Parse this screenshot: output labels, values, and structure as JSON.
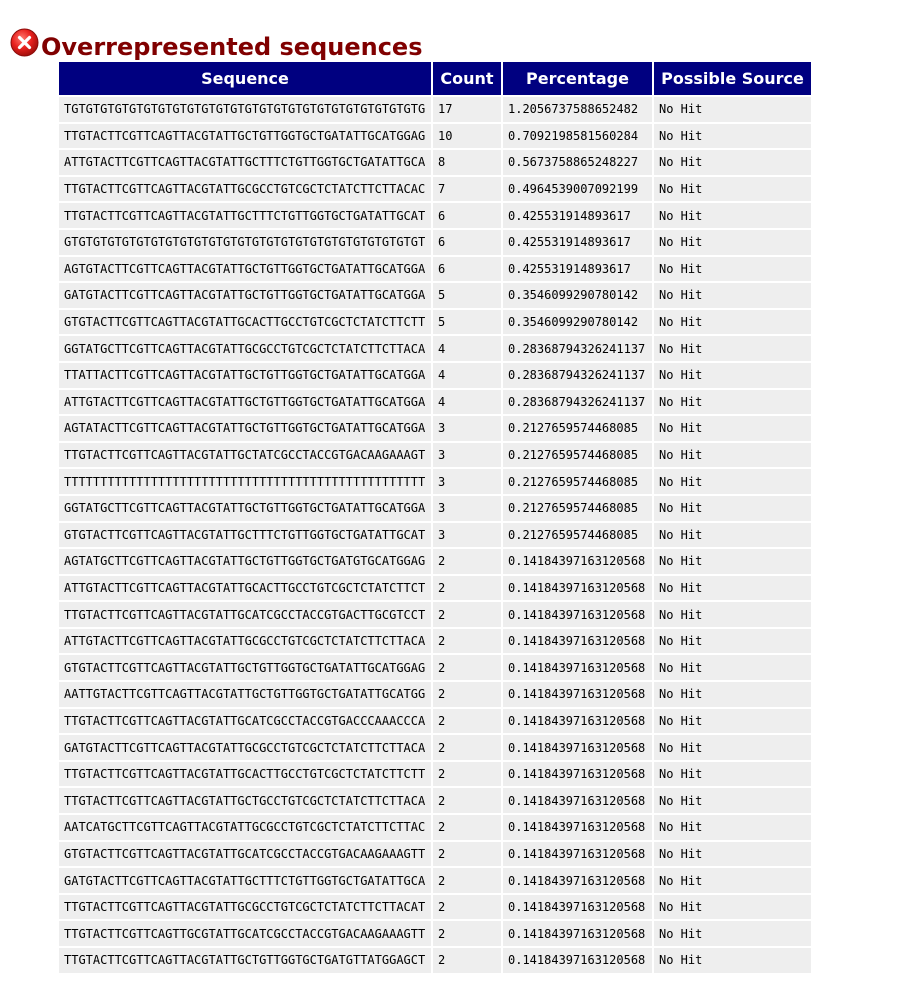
{
  "report": {
    "title": "Overrepresented sequences",
    "status": "fail",
    "status_icon": "fail-cross-icon",
    "status_color": "#e8211e",
    "title_color": "#800000",
    "header_bg": "#000080"
  },
  "table": {
    "columns": [
      "Sequence",
      "Count",
      "Percentage",
      "Possible Source"
    ],
    "rows": [
      {
        "sequence": "TGTGTGTGTGTGTGTGTGTGTGTGTGTGTGTGTGTGTGTGTGTGTGTGTG",
        "count": "17",
        "percentage": "1.2056737588652482",
        "source": "No Hit"
      },
      {
        "sequence": "TTGTACTTCGTTCAGTTACGTATTGCTGTTGGTGCTGATATTGCATGGAG",
        "count": "10",
        "percentage": "0.7092198581560284",
        "source": "No Hit"
      },
      {
        "sequence": "ATTGTACTTCGTTCAGTTACGTATTGCTTTCTGTTGGTGCTGATATTGCA",
        "count": "8",
        "percentage": "0.5673758865248227",
        "source": "No Hit"
      },
      {
        "sequence": "TTGTACTTCGTTCAGTTACGTATTGCGCCTGTCGCTCTATCTTCTTACAC",
        "count": "7",
        "percentage": "0.4964539007092199",
        "source": "No Hit"
      },
      {
        "sequence": "TTGTACTTCGTTCAGTTACGTATTGCTTTCTGTTGGTGCTGATATTGCAT",
        "count": "6",
        "percentage": "0.425531914893617",
        "source": "No Hit"
      },
      {
        "sequence": "GTGTGTGTGTGTGTGTGTGTGTGTGTGTGTGTGTGTGTGTGTGTGTGTGT",
        "count": "6",
        "percentage": "0.425531914893617",
        "source": "No Hit"
      },
      {
        "sequence": "AGTGTACTTCGTTCAGTTACGTATTGCTGTTGGTGCTGATATTGCATGGA",
        "count": "6",
        "percentage": "0.425531914893617",
        "source": "No Hit"
      },
      {
        "sequence": "GATGTACTTCGTTCAGTTACGTATTGCTGTTGGTGCTGATATTGCATGGA",
        "count": "5",
        "percentage": "0.3546099290780142",
        "source": "No Hit"
      },
      {
        "sequence": "GTGTACTTCGTTCAGTTACGTATTGCACTTGCCTGTCGCTCTATCTTCTT",
        "count": "5",
        "percentage": "0.3546099290780142",
        "source": "No Hit"
      },
      {
        "sequence": "GGTATGCTTCGTTCAGTTACGTATTGCGCCTGTCGCTCTATCTTCTTACA",
        "count": "4",
        "percentage": "0.28368794326241137",
        "source": "No Hit"
      },
      {
        "sequence": "TTATTACTTCGTTCAGTTACGTATTGCTGTTGGTGCTGATATTGCATGGA",
        "count": "4",
        "percentage": "0.28368794326241137",
        "source": "No Hit"
      },
      {
        "sequence": "ATTGTACTTCGTTCAGTTACGTATTGCTGTTGGTGCTGATATTGCATGGA",
        "count": "4",
        "percentage": "0.28368794326241137",
        "source": "No Hit"
      },
      {
        "sequence": "AGTATACTTCGTTCAGTTACGTATTGCTGTTGGTGCTGATATTGCATGGA",
        "count": "3",
        "percentage": "0.2127659574468085",
        "source": "No Hit"
      },
      {
        "sequence": "TTGTACTTCGTTCAGTTACGTATTGCTATCGCCTACCGTGACAAGAAAGT",
        "count": "3",
        "percentage": "0.2127659574468085",
        "source": "No Hit"
      },
      {
        "sequence": "TTTTTTTTTTTTTTTTTTTTTTTTTTTTTTTTTTTTTTTTTTTTTTTTTT",
        "count": "3",
        "percentage": "0.2127659574468085",
        "source": "No Hit"
      },
      {
        "sequence": "GGTATGCTTCGTTCAGTTACGTATTGCTGTTGGTGCTGATATTGCATGGA",
        "count": "3",
        "percentage": "0.2127659574468085",
        "source": "No Hit"
      },
      {
        "sequence": "GTGTACTTCGTTCAGTTACGTATTGCTTTCTGTTGGTGCTGATATTGCAT",
        "count": "3",
        "percentage": "0.2127659574468085",
        "source": "No Hit"
      },
      {
        "sequence": "AGTATGCTTCGTTCAGTTACGTATTGCTGTTGGTGCTGATGTGCATGGAG",
        "count": "2",
        "percentage": "0.14184397163120568",
        "source": "No Hit"
      },
      {
        "sequence": "ATTGTACTTCGTTCAGTTACGTATTGCACTTGCCTGTCGCTCTATCTTCT",
        "count": "2",
        "percentage": "0.14184397163120568",
        "source": "No Hit"
      },
      {
        "sequence": "TTGTACTTCGTTCAGTTACGTATTGCATCGCCTACCGTGACTTGCGTCCT",
        "count": "2",
        "percentage": "0.14184397163120568",
        "source": "No Hit"
      },
      {
        "sequence": "ATTGTACTTCGTTCAGTTACGTATTGCGCCTGTCGCTCTATCTTCTTACA",
        "count": "2",
        "percentage": "0.14184397163120568",
        "source": "No Hit"
      },
      {
        "sequence": "GTGTACTTCGTTCAGTTACGTATTGCTGTTGGTGCTGATATTGCATGGAG",
        "count": "2",
        "percentage": "0.14184397163120568",
        "source": "No Hit"
      },
      {
        "sequence": "AATTGTACTTCGTTCAGTTACGTATTGCTGTTGGTGCTGATATTGCATGG",
        "count": "2",
        "percentage": "0.14184397163120568",
        "source": "No Hit"
      },
      {
        "sequence": "TTGTACTTCGTTCAGTTACGTATTGCATCGCCTACCGTGACCCAAACCCA",
        "count": "2",
        "percentage": "0.14184397163120568",
        "source": "No Hit"
      },
      {
        "sequence": "GATGTACTTCGTTCAGTTACGTATTGCGCCTGTCGCTCTATCTTCTTACA",
        "count": "2",
        "percentage": "0.14184397163120568",
        "source": "No Hit"
      },
      {
        "sequence": "TTGTACTTCGTTCAGTTACGTATTGCACTTGCCTGTCGCTCTATCTTCTT",
        "count": "2",
        "percentage": "0.14184397163120568",
        "source": "No Hit"
      },
      {
        "sequence": "TTGTACTTCGTTCAGTTACGTATTGCTGCCTGTCGCTCTATCTTCTTACA",
        "count": "2",
        "percentage": "0.14184397163120568",
        "source": "No Hit"
      },
      {
        "sequence": "AATCATGCTTCGTTCAGTTACGTATTGCGCCTGTCGCTCTATCTTCTTAC",
        "count": "2",
        "percentage": "0.14184397163120568",
        "source": "No Hit"
      },
      {
        "sequence": "GTGTACTTCGTTCAGTTACGTATTGCATCGCCTACCGTGACAAGAAAGTT",
        "count": "2",
        "percentage": "0.14184397163120568",
        "source": "No Hit"
      },
      {
        "sequence": "GATGTACTTCGTTCAGTTACGTATTGCTTTCTGTTGGTGCTGATATTGCA",
        "count": "2",
        "percentage": "0.14184397163120568",
        "source": "No Hit"
      },
      {
        "sequence": "TTGTACTTCGTTCAGTTACGTATTGCGCCTGTCGCTCTATCTTCTTACAT",
        "count": "2",
        "percentage": "0.14184397163120568",
        "source": "No Hit"
      },
      {
        "sequence": "TTGTACTTCGTTCAGTTGCGTATTGCATCGCCTACCGTGACAAGAAAGTT",
        "count": "2",
        "percentage": "0.14184397163120568",
        "source": "No Hit"
      },
      {
        "sequence": "TTGTACTTCGTTCAGTTACGTATTGCTGTTGGTGCTGATGTTATGGAGCT",
        "count": "2",
        "percentage": "0.14184397163120568",
        "source": "No Hit"
      }
    ]
  }
}
